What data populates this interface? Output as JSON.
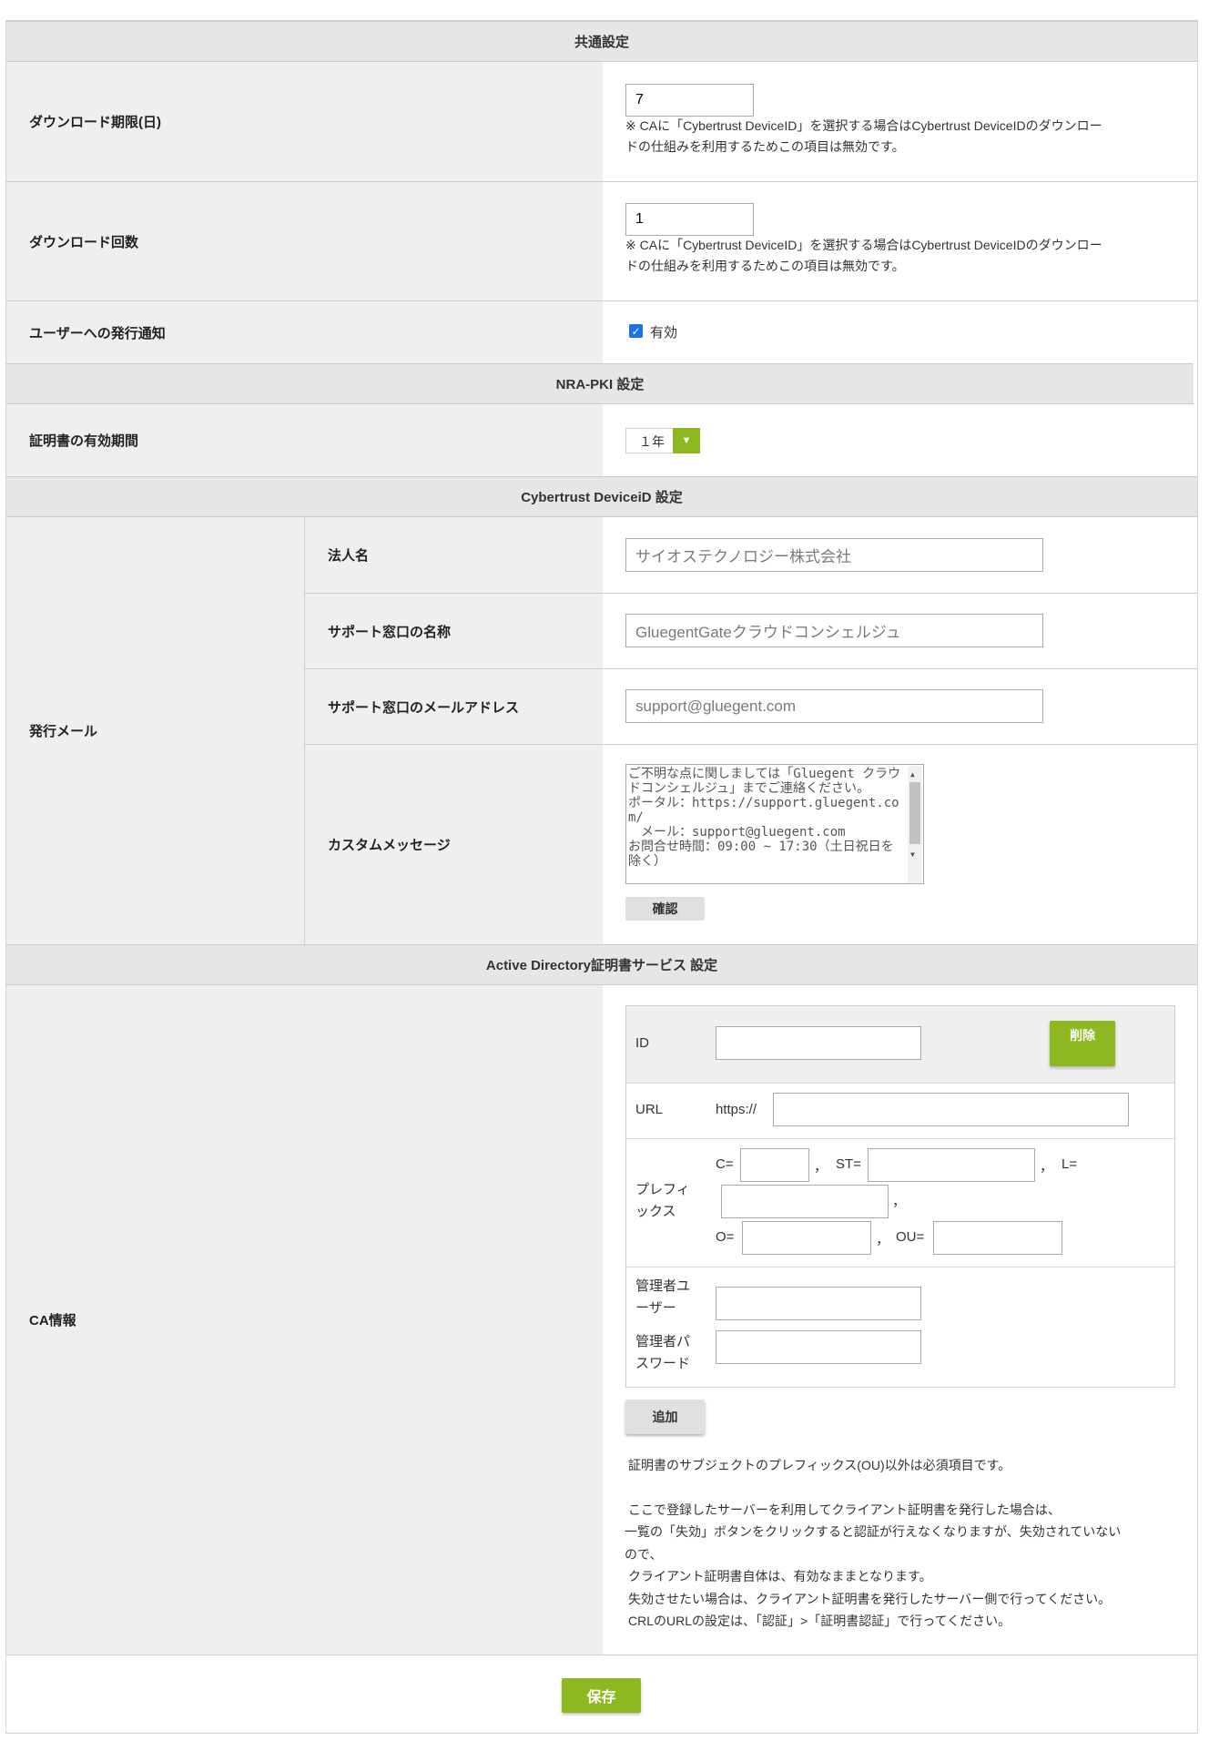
{
  "sections": {
    "common": "共通設定",
    "nra": "NRA-PKI 設定",
    "cybertrust": "Cybertrust DeviceiD 設定",
    "adcs": "Active Directory証明書サービス 設定"
  },
  "common": {
    "download_days": {
      "label": "ダウンロード期限(日)",
      "value": "7",
      "note_line1": "※ CAに「Cybertrust DeviceID」を選択する場合はCybertrust DeviceIDのダウンロー",
      "note_line2": "ドの仕組みを利用するためこの項目は無効です。"
    },
    "download_count": {
      "label": "ダウンロード回数",
      "value": "1",
      "note_line1": "※ CAに「Cybertrust DeviceID」を選択する場合はCybertrust DeviceIDのダウンロー",
      "note_line2": "ドの仕組みを利用するためこの項目は無効です。"
    },
    "notify": {
      "label": "ユーザーへの発行通知",
      "checkbox_label": "有効",
      "checked": true
    }
  },
  "nra": {
    "validity": {
      "label": "証明書の有効期間",
      "selected": "１年"
    }
  },
  "cybertrust": {
    "group_label": "発行メール",
    "corp_name": {
      "label": "法人名",
      "placeholder": "サイオステクノロジー株式会社"
    },
    "support_name": {
      "label": "サポート窓口の名称",
      "placeholder": "GluegentGateクラウドコンシェルジュ"
    },
    "support_mail": {
      "label": "サポート窓口のメールアドレス",
      "placeholder": "support@gluegent.com"
    },
    "custom_message": {
      "label": "カスタムメッセージ",
      "text": "ご不明な点に関しましては「Gluegent クラウドコンシェルジュ」までご連絡ください。\nポータル：https://support.gluegent.com/\n　メール：support@gluegent.com\nお問合せ時間：09:00 ~ 17:30（土日祝日を除く）",
      "confirm_label": "確認"
    }
  },
  "adcs": {
    "ca_label": "CA情報",
    "id_label": "ID",
    "delete_label": "削除",
    "url_label": "URL",
    "url_prefix": "https://",
    "prefix_label_1": "プレフィ",
    "prefix_label_2": "ックス",
    "c_label": "C=",
    "st_label": "ST=",
    "l_label": "L=",
    "o_label": "O=",
    "ou_label": "OU=",
    "comma": "，",
    "admin_user_1": "管理者ユ",
    "admin_user_2": "ーザー",
    "admin_pass_1": "管理者パ",
    "admin_pass_2": "スワード",
    "add_label": "追加",
    "notes": [
      "証明書のサブジェクトのプレフィックス(OU)以外は必須項目です。",
      "",
      "ここで登録したサーバーを利用してクライアント証明書を発行した場合は、",
      "一覧の「失効」ボタンをクリックすると認証が行えなくなりますが、失効されていない",
      "ので、",
      "クライアント証明書自体は、有効なままとなります。",
      "失効させたい場合は、クライアント証明書を発行したサーバー側で行ってください。",
      "CRLのURLの設定は、「認証」>「証明書認証」で行ってください。"
    ]
  },
  "footer": {
    "save_label": "保存"
  },
  "colors": {
    "accent": "#8db81f",
    "header_bg": "#e6e6e6",
    "label_bg": "#efefef",
    "border": "#c5d0d6"
  }
}
